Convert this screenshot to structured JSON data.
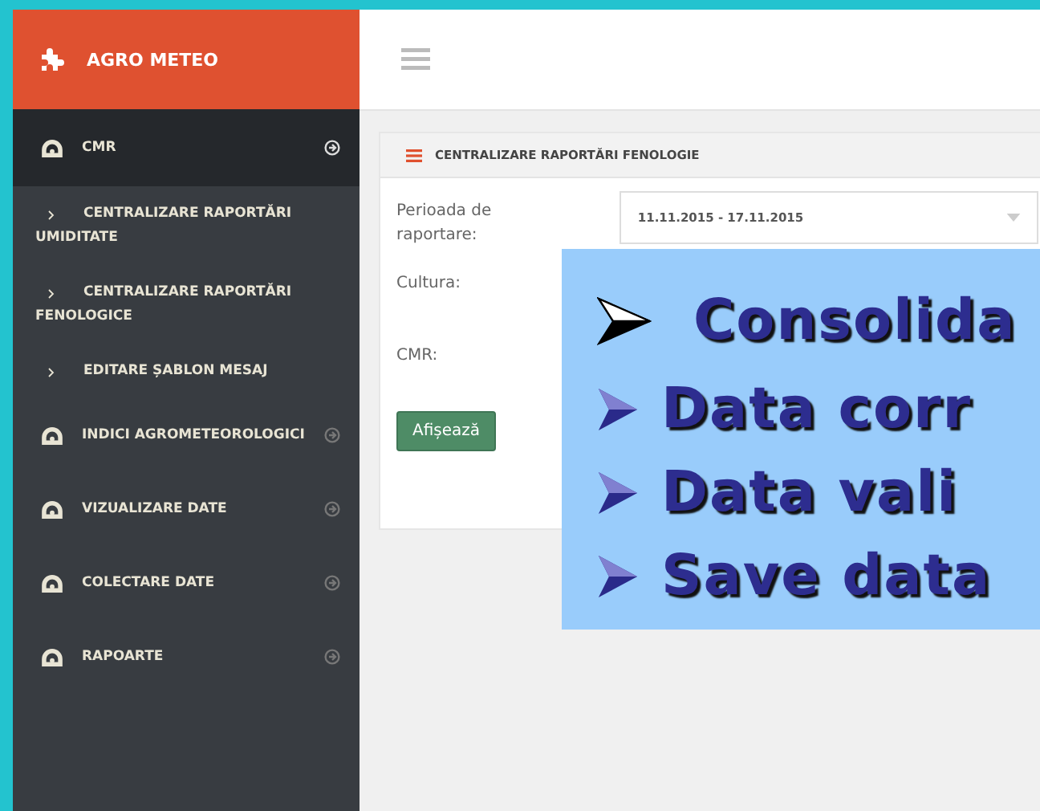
{
  "brand": {
    "title": "AGRO METEO"
  },
  "sidebar": {
    "items": [
      {
        "label": "CMR",
        "selected": true,
        "children": [
          {
            "label": "CENTRALIZARE RAPORTĂRI UMIDITATE"
          },
          {
            "label": "CENTRALIZARE RAPORTĂRI FENOLOGICE"
          },
          {
            "label": "EDITARE ȘABLON MESAJ"
          }
        ]
      },
      {
        "label": "INDICI AGROMETEOROLOGICI",
        "selected": false
      },
      {
        "label": "VIZUALIZARE DATE",
        "selected": false
      },
      {
        "label": "COLECTARE DATE",
        "selected": false
      },
      {
        "label": "RAPOARTE",
        "selected": false
      }
    ]
  },
  "panel": {
    "title": "CENTRALIZARE RAPORTĂRI FENOLOGIE",
    "fields": [
      {
        "label": "Perioada de raportare:",
        "kind": "select",
        "value": "11.11.2015 - 17.11.2015"
      },
      {
        "label": "Cultura:",
        "kind": "empty"
      },
      {
        "label": "CMR:",
        "kind": "empty"
      }
    ],
    "button": "Afișează"
  },
  "overlay": {
    "bullets": [
      {
        "text": "Consolida",
        "kind": "black"
      },
      {
        "text": "Data corr",
        "kind": "blue"
      },
      {
        "text": "Data vali",
        "kind": "blue"
      },
      {
        "text": "Save data",
        "kind": "blue"
      }
    ]
  }
}
